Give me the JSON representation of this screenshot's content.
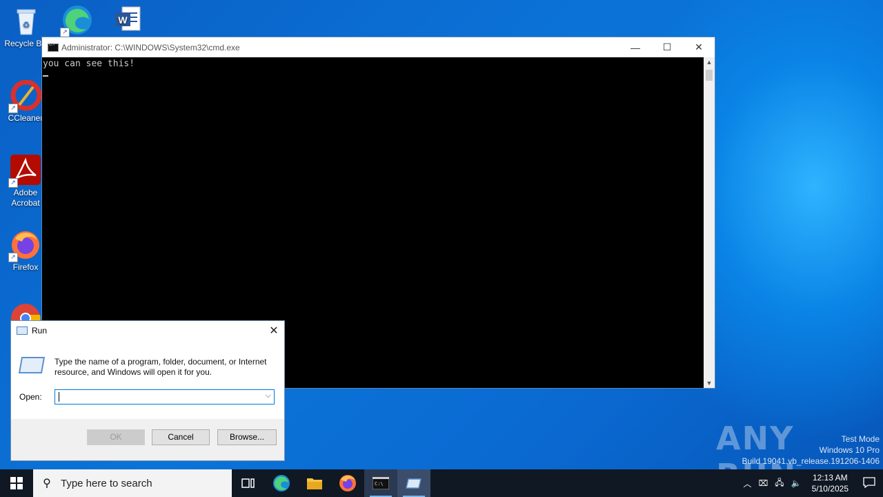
{
  "desktop": {
    "icons": [
      {
        "label": "Recycle Bin",
        "icon": "recycle-bin-icon"
      },
      {
        "label": "",
        "icon": "edge-icon"
      },
      {
        "label": "",
        "icon": "word-icon"
      },
      {
        "label": "CCleaner",
        "icon": "ccleaner-icon"
      },
      {
        "label": "Adobe Acrobat",
        "icon": "acrobat-icon"
      },
      {
        "label": "Firefox",
        "icon": "firefox-icon"
      },
      {
        "label": "",
        "icon": "chrome-icon"
      }
    ]
  },
  "cmd": {
    "title": "Administrator: C:\\WINDOWS\\System32\\cmd.exe",
    "output": "you can see this!",
    "controls": {
      "minimize": "—",
      "maximize": "☐",
      "close": "✕"
    }
  },
  "run": {
    "title": "Run",
    "description": "Type the name of a program, folder, document, or Internet resource, and Windows will open it for you.",
    "open_label": "Open:",
    "open_value": "",
    "ok_label": "OK",
    "cancel_label": "Cancel",
    "browse_label": "Browse..."
  },
  "watermark": {
    "brand": "ANY RUN",
    "line1": "Test Mode",
    "line2": "Windows 10 Pro",
    "line3": "Build 19041.vb_release.191206-1406"
  },
  "taskbar": {
    "search_placeholder": "Type here to search",
    "time": "12:13 AM",
    "date": "5/10/2025",
    "apps": [
      "task-view-icon",
      "edge-icon",
      "file-explorer-icon",
      "firefox-icon",
      "cmd-icon",
      "run-icon"
    ]
  },
  "colors": {
    "accent": "#0078d7",
    "taskbar": "#101824",
    "console_bg": "#000000"
  }
}
